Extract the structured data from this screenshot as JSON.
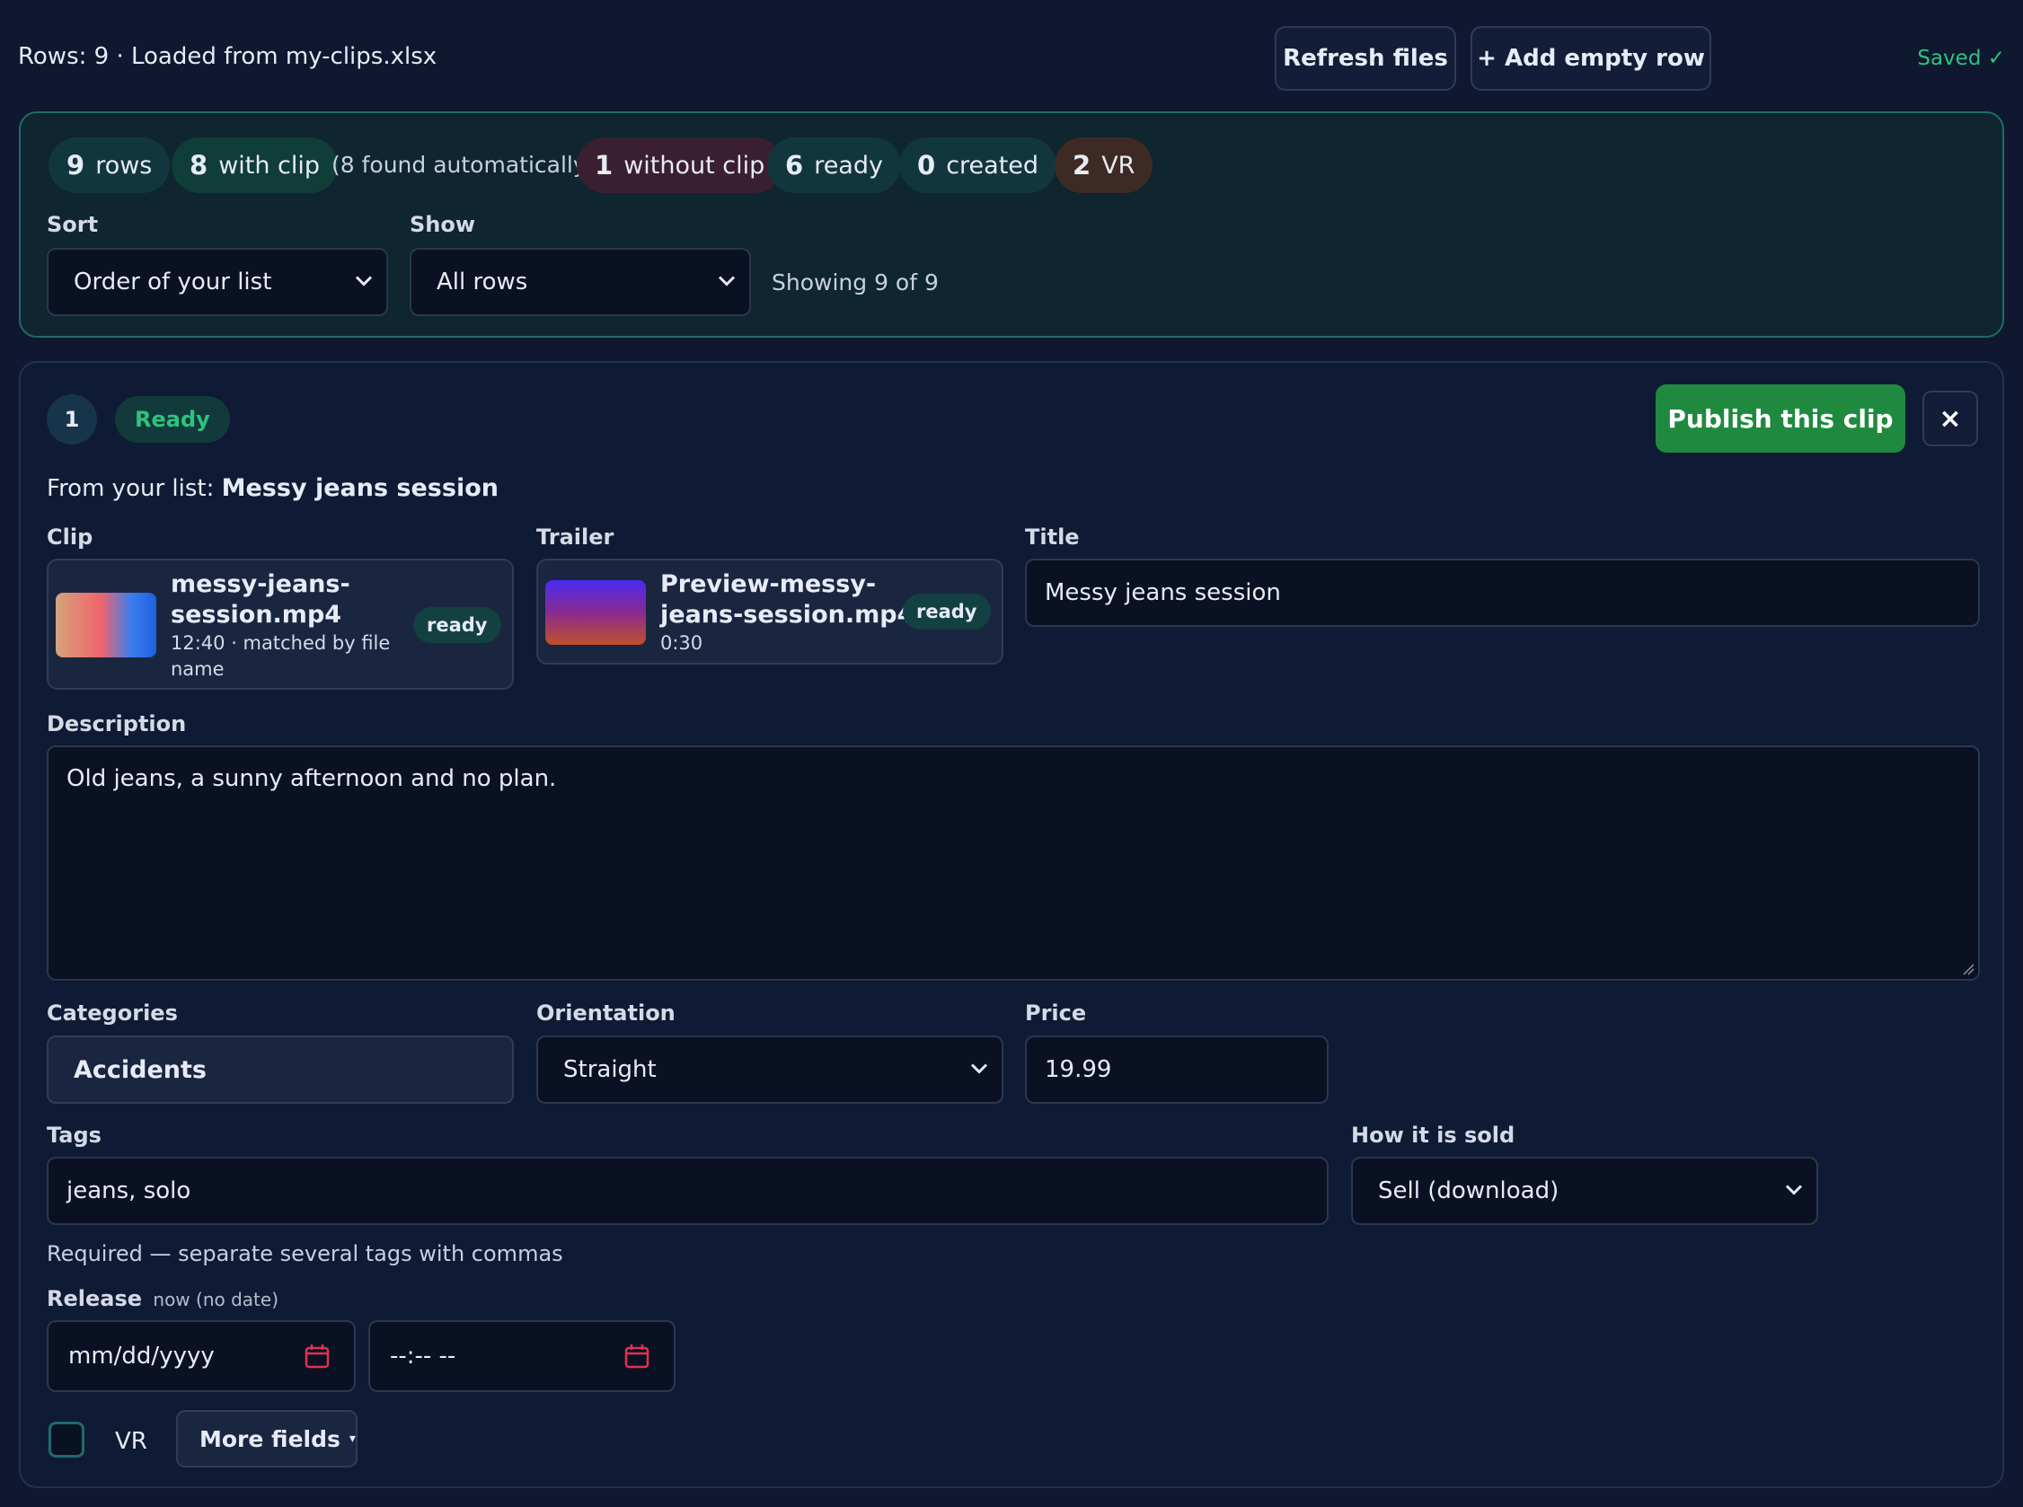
{
  "topbar": {
    "status": "Rows: 9 · Loaded from my-clips.xlsx",
    "refresh_label": "Refresh files",
    "add_row_label": "+ Add empty row",
    "saved": "Saved ✓"
  },
  "summary": {
    "pills": {
      "rows_count": "9",
      "rows_label": "rows",
      "with_clip_count": "8",
      "with_clip_label": "with clip",
      "auto_note": "(8 found automatically)",
      "without_clip_count": "1",
      "without_clip_label": "without clip",
      "ready_count": "6",
      "ready_label": "ready",
      "created_count": "0",
      "created_label": "created",
      "vr_count": "2",
      "vr_label": "VR"
    },
    "sort_label": "Sort",
    "sort_value": "Order of your list",
    "show_label": "Show",
    "show_value": "All rows",
    "showing": "Showing 9 of 9"
  },
  "card": {
    "number": "1",
    "status": "Ready",
    "publish_label": "Publish this clip",
    "close_label": "×",
    "from_list_prefix": "From your list:",
    "from_list_name": "Messy jeans session",
    "clip": {
      "label": "Clip",
      "name_line1": "messy-jeans-",
      "name_line2": "session.mp4",
      "meta_line1": "12:40 · matched by file",
      "meta_line2": "name",
      "badge": "ready"
    },
    "trailer": {
      "label": "Trailer",
      "name_line1": "Preview-messy-",
      "name_line2": "jeans-session.mp4",
      "meta_line1": "0:30",
      "badge": "ready"
    },
    "title": {
      "label": "Title",
      "value": "Messy jeans session"
    },
    "description": {
      "label": "Description",
      "value": "Old jeans, a sunny afternoon and no plan."
    },
    "categories": {
      "label": "Categories",
      "value": "Accidents"
    },
    "orientation": {
      "label": "Orientation",
      "value": "Straight"
    },
    "price": {
      "label": "Price",
      "value": "19.99"
    },
    "tags": {
      "label": "Tags",
      "value": "jeans, solo",
      "hint": "Required — separate several tags with commas"
    },
    "sold": {
      "label": "How it is sold",
      "value": "Sell (download)"
    },
    "release": {
      "label": "Release",
      "note": "now (no date)",
      "date_placeholder": "mm/dd/yyyy",
      "time_placeholder": "--:-- --"
    },
    "vr_label": "VR",
    "more_fields_label": "More fields",
    "more_fields_icon": "▾"
  },
  "colors": {
    "background": "#0f1830",
    "accent_green": "#2ec27e",
    "publish_green": "#1f8a3f",
    "calendar_red": "#e0334f"
  },
  "icons": {
    "select": "chevron-down-icon",
    "calendar": "calendar-icon",
    "close": "close-icon"
  }
}
